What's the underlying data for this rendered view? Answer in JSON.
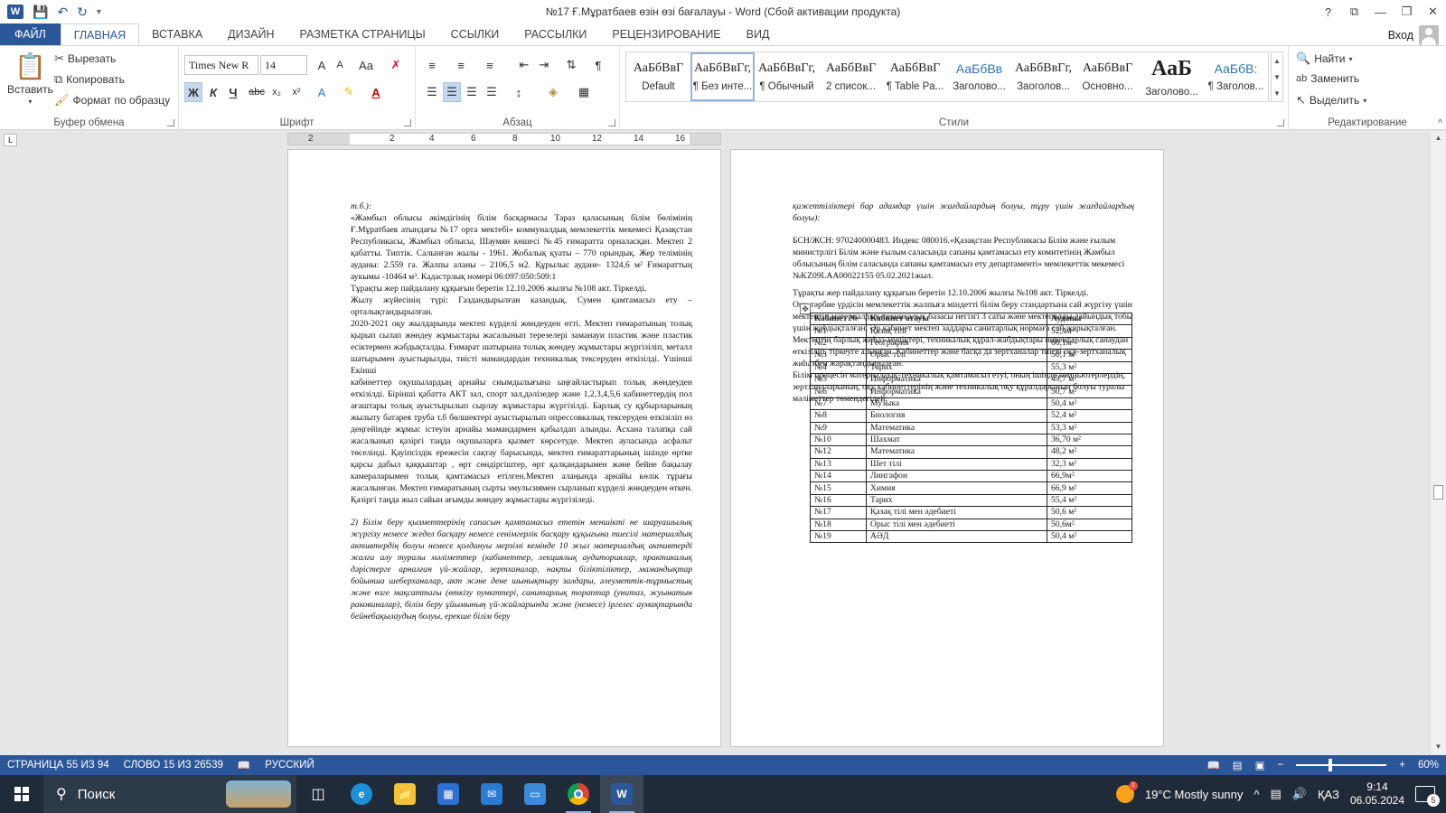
{
  "window": {
    "title": "№17 Ғ.Мұратбаев өзін өзі бағалауы - Word (Сбой активации продукта)",
    "controls": [
      "?",
      "⧉",
      "—",
      "❐",
      "✕"
    ]
  },
  "tabs": [
    {
      "label": "ФАЙЛ"
    },
    {
      "label": "ГЛАВНАЯ"
    },
    {
      "label": "ВСТАВКА"
    },
    {
      "label": "ДИЗАЙН"
    },
    {
      "label": "РАЗМЕТКА СТРАНИЦЫ"
    },
    {
      "label": "ССЫЛКИ"
    },
    {
      "label": "РАССЫЛКИ"
    },
    {
      "label": "РЕЦЕНЗИРОВАНИЕ"
    },
    {
      "label": "ВИД"
    }
  ],
  "signin": "Вход",
  "ribbon": {
    "clipboard": {
      "label": "Буфер обмена",
      "paste": "Вставить",
      "cut": "Вырезать",
      "copy": "Копировать",
      "format_painter": "Формат по образцу"
    },
    "font": {
      "label": "Шрифт",
      "font_name": "Times New R",
      "font_size": "14",
      "bold": "Ж",
      "italic": "К",
      "underline": "Ч",
      "strike": "abc",
      "sub": "x₂",
      "sup": "x²",
      "case": "Aa",
      "grow": "A",
      "shrink": "A"
    },
    "paragraph": {
      "label": "Абзац"
    },
    "styles": {
      "label": "Стили",
      "items": [
        {
          "preview": "АаБбВвГ",
          "name": "Default"
        },
        {
          "preview": "АаБбВвГг,",
          "name": "¶ Без инте..."
        },
        {
          "preview": "АаБбВвГг,",
          "name": "¶ Обычный"
        },
        {
          "preview": "АаБбВвГ",
          "name": "2 список..."
        },
        {
          "preview": "АаБбВвГ",
          "name": "¶ Table Pa..."
        },
        {
          "preview": "АаБбВв",
          "name": "Заголово..."
        },
        {
          "preview": "АаБбВвГг,",
          "name": "Заоголов..."
        },
        {
          "preview": "АаБбВвГ",
          "name": "Основно..."
        },
        {
          "preview": "АаБ",
          "name": "Заголово..."
        },
        {
          "preview": "АаБбВ:",
          "name": "¶ Заголов..."
        }
      ]
    },
    "editing": {
      "label": "Редактирование",
      "find": "Найти",
      "replace": "Заменить",
      "select": "Выделить"
    }
  },
  "ruler": {
    "numbers": [
      "2",
      "2",
      "4",
      "6",
      "8",
      "10",
      "12",
      "14",
      "16"
    ]
  },
  "page1": {
    "paragraphs": [
      {
        "text": "т.б.):",
        "italic": true
      },
      {
        "text": "«Жамбыл облысы әкімдігінің білім басқармасы Тараз қаласының білім бөлімінің Ғ.Мұратбаев атындағы №17 орта мектебі» коммуналдық мемлекеттік мекемесі Қазақстан Республикасы, Жамбыл облысы, Шаумян көшесі №45 ғимаратта орналасқан. Мектеп 2 қабатты. Типтік. Салынған жылы - 1961. Жобалық қуаты – 770 орындық. Жер телімінің ауданы: 2.559 га. Жалпы аланы – 2106,5 м2. Құрылыс аудане- 1324,6 м² Ғимараттың аукымы -10464 м³. Кадастрлық номері 06:097:050:509:1",
        "italic": false
      },
      {
        "text": "Тұрақты жер пайдалану құқығын беретін 12.10.2006 жылғы №108 акт. Тіркелді.",
        "italic": false
      },
      {
        "text": "Жылу жүйесінің түрі: Газдандырылған казандық. Сумен қамтамасыз ету – орталықтандырылған.",
        "italic": false
      },
      {
        "text": "2020-2021 оқу жылдарында мектеп күрделі жөндеуден өтті. Мектеп ғимаратының толық қырып сылап жөндеу жұмыстары жасалынып терезелері заманауи пластик және пластик есіктермен жабдықталды. Ғимарат шатырына толық жөндеу жұмыстары жүргізіліп, металл шатырымен ауыстырылды, тиісті мамандардан техникалық тексеруден өткізілді. Үшінші Екінші",
        "italic": false
      },
      {
        "text": "кабинеттер оқушылардың арнайы сиымдылығына ыңғайластырып толық жөндеуден өткізілді. Бірінші қабатта АКТ зал, спорт зал,дәлізедер және 1,2,3,4,5,6 кабинеттердің пол ағаштары толық ауыстырылып сырлау жұмыстары жүргізілді. Барлық су құбырларының жылыту батарея труба т.б бөлшектері ауыстырылып опрессовкалық тексеруден өткізіліп өз деңгейінде жұмыс істеуін арнайы мамандармен қабылдап алынды. Асхана талапқа сай жасалынып қазіргі таңда оқушыларға қызмет көрсетуде. Мектеп ауласында асфальт төселінді. Қауіпсіздік ережесін сақтау барысында, мектеп ғимараттарының ішінде өртке қарсы дабыл қаққыштар , өрт сөндіргіштер, өрт қалқандарымен және бейне бақылау камераларымен толық қамтамасыз етілген.Мектеп алаңында арнайы көлік тұрағы жасалынған. Мектеп ғимаратының сырты эмульсиямен сырланып күрделі жөндеуден өткен. Қазіргі таңда жыл сайын ағымды жөндеу жұмыстары жүргізіледі.",
        "italic": false
      },
      {
        "text": "2) Білім беру қызметтерінің сапасын қамтамасыз ететін меншікті не шаруашылық жүргізу немесе жедел басқару немесе сенімгерлік басқару құқығына тиесілі материалдық активтердің болуы немесе қолдануы мерзімі кемінде 10 жыл материалдық активтерді жалға алу туралы мәліметтер (кабинеттер, лекциялық аудиториялар, практикалық дәрістерге арналған үй-жайлар, зертханалар, нақты біліктіліктер, мамандықтар бойынша шеберханалар, акт және дене шынықтыру залдары, әлеуметтік-тұрмыстық және өзге мақсаттағы (өткізу пункттері, санитарлық тораптар (унитаз, жуынатын раковиналар), білім беру ұйымының үй-жайларында және (немесе) іргелес аумақтарында бейнебақылаудың болуы, ерекше білім беру",
        "italic": true
      }
    ]
  },
  "page2": {
    "paragraphs": [
      {
        "text": "қажеттіліктері бар адамдар үшін жағдайлардың болуы, тұру үшін жағдайлардың болуы):",
        "italic": true
      },
      {
        "text": "БСН/ЖСН: 970240000483. Индекс 080016.«Қазақстан Республикасы Білім және ғылым министрлігі Білім және ғылым саласында сапаны қамтамасыз ету комитетінің Жамбыл облысының білім саласында сапаны қамтамасыз ету департаменті» мемлекеттік мекемесі №KZ09LAA00022155 05.02.2021жыл.",
        "italic": false
      },
      {
        "text": "Тұрақты жер пайдалану құқығын беретін 12.10.2006 жылғы №108 акт. Тіркелді.",
        "italic": false
      },
      {
        "text": "Оқу-тәрбие үрдісін мемлекеттік жалпыға міндетті білім беру стандартына сай жүргізу үшін мектептің материалдық-техникалық базасы негізгі 3 саты және мектепалды дайындық тобы үшін жабдықталған. Әр кабинет мектеп заддары санитарлық нормаға сай жарықталған.",
        "italic": false
      },
      {
        "text": "Мектептің барлық жиһаз-мүліктері, техникалық құрал-жабдықтары инвентарлық санаудан өткізіліп, тіркеуге алынған. Кабинеттер және басқа да зертханалар тиісті оқу-зертханалық жиһазбен жарақтандырылған.",
        "italic": false
      },
      {
        "text": "Білім процесін материалдық-техникалық қамтамасыз етуі, оның ішінде компьютерлердің, зертханаларының, оқу кабинеттерінің және техникалық оқу құралдарының болуы туралы мәліметтер төмендегідей:",
        "italic": false
      }
    ],
    "table": {
      "headers": [
        "Кабинет №",
        "Кабинет атауы",
        "Ауданы"
      ],
      "rows": [
        [
          "№1",
          "Қазақ тілі",
          "52,4м²"
        ],
        [
          "№2",
          "География",
          "66,1м²"
        ],
        [
          "№3",
          "Орыс тілі",
          "50,1 м²"
        ],
        [
          "№4",
          "Тарих",
          "55,3 м²"
        ],
        [
          "№5",
          "Информатика",
          "49,7 м²"
        ],
        [
          "№6",
          "Информатика",
          "50,7 м²"
        ],
        [
          "№7",
          "Музыка",
          "50,4 м²"
        ],
        [
          "№8",
          "Биология",
          "52,4 м²"
        ],
        [
          "№9",
          "Математика",
          "53,3 м²"
        ],
        [
          "№10",
          "Шахмат",
          "36,70 м²"
        ],
        [
          "№12",
          "Математика",
          "48,2 м²"
        ],
        [
          "№13",
          "Шет тілі",
          "32,3 м²"
        ],
        [
          "№14",
          "Лингафон",
          "66,9м²"
        ],
        [
          "№15",
          "Химия",
          "66,9 м²"
        ],
        [
          "№16",
          "Тарих",
          "55,4 м²"
        ],
        [
          "№17",
          "Қазақ тілі мен әдебиеті",
          "50,6 м²"
        ],
        [
          "№18",
          "Орыс тілі мен әдебиеті",
          "50,6м²"
        ],
        [
          "№19",
          "АӘД",
          "50,4 м²"
        ]
      ]
    }
  },
  "statusbar": {
    "page": "СТРАНИЦА 55 ИЗ 94",
    "words": "СЛОВО 15 ИЗ 26539",
    "language": "РУССКИЙ",
    "zoom": "60%",
    "zoom_fraction": 0.38
  },
  "taskbar": {
    "search": "Поиск",
    "weather": "19°C  Mostly sunny",
    "weather_badge": "1",
    "lang": "ҚАЗ",
    "time": "9:14",
    "date": "06.05.2024",
    "notif_count": "5"
  },
  "colors": {
    "accent": "#2b579a",
    "taskbar": "#1f2b38"
  }
}
